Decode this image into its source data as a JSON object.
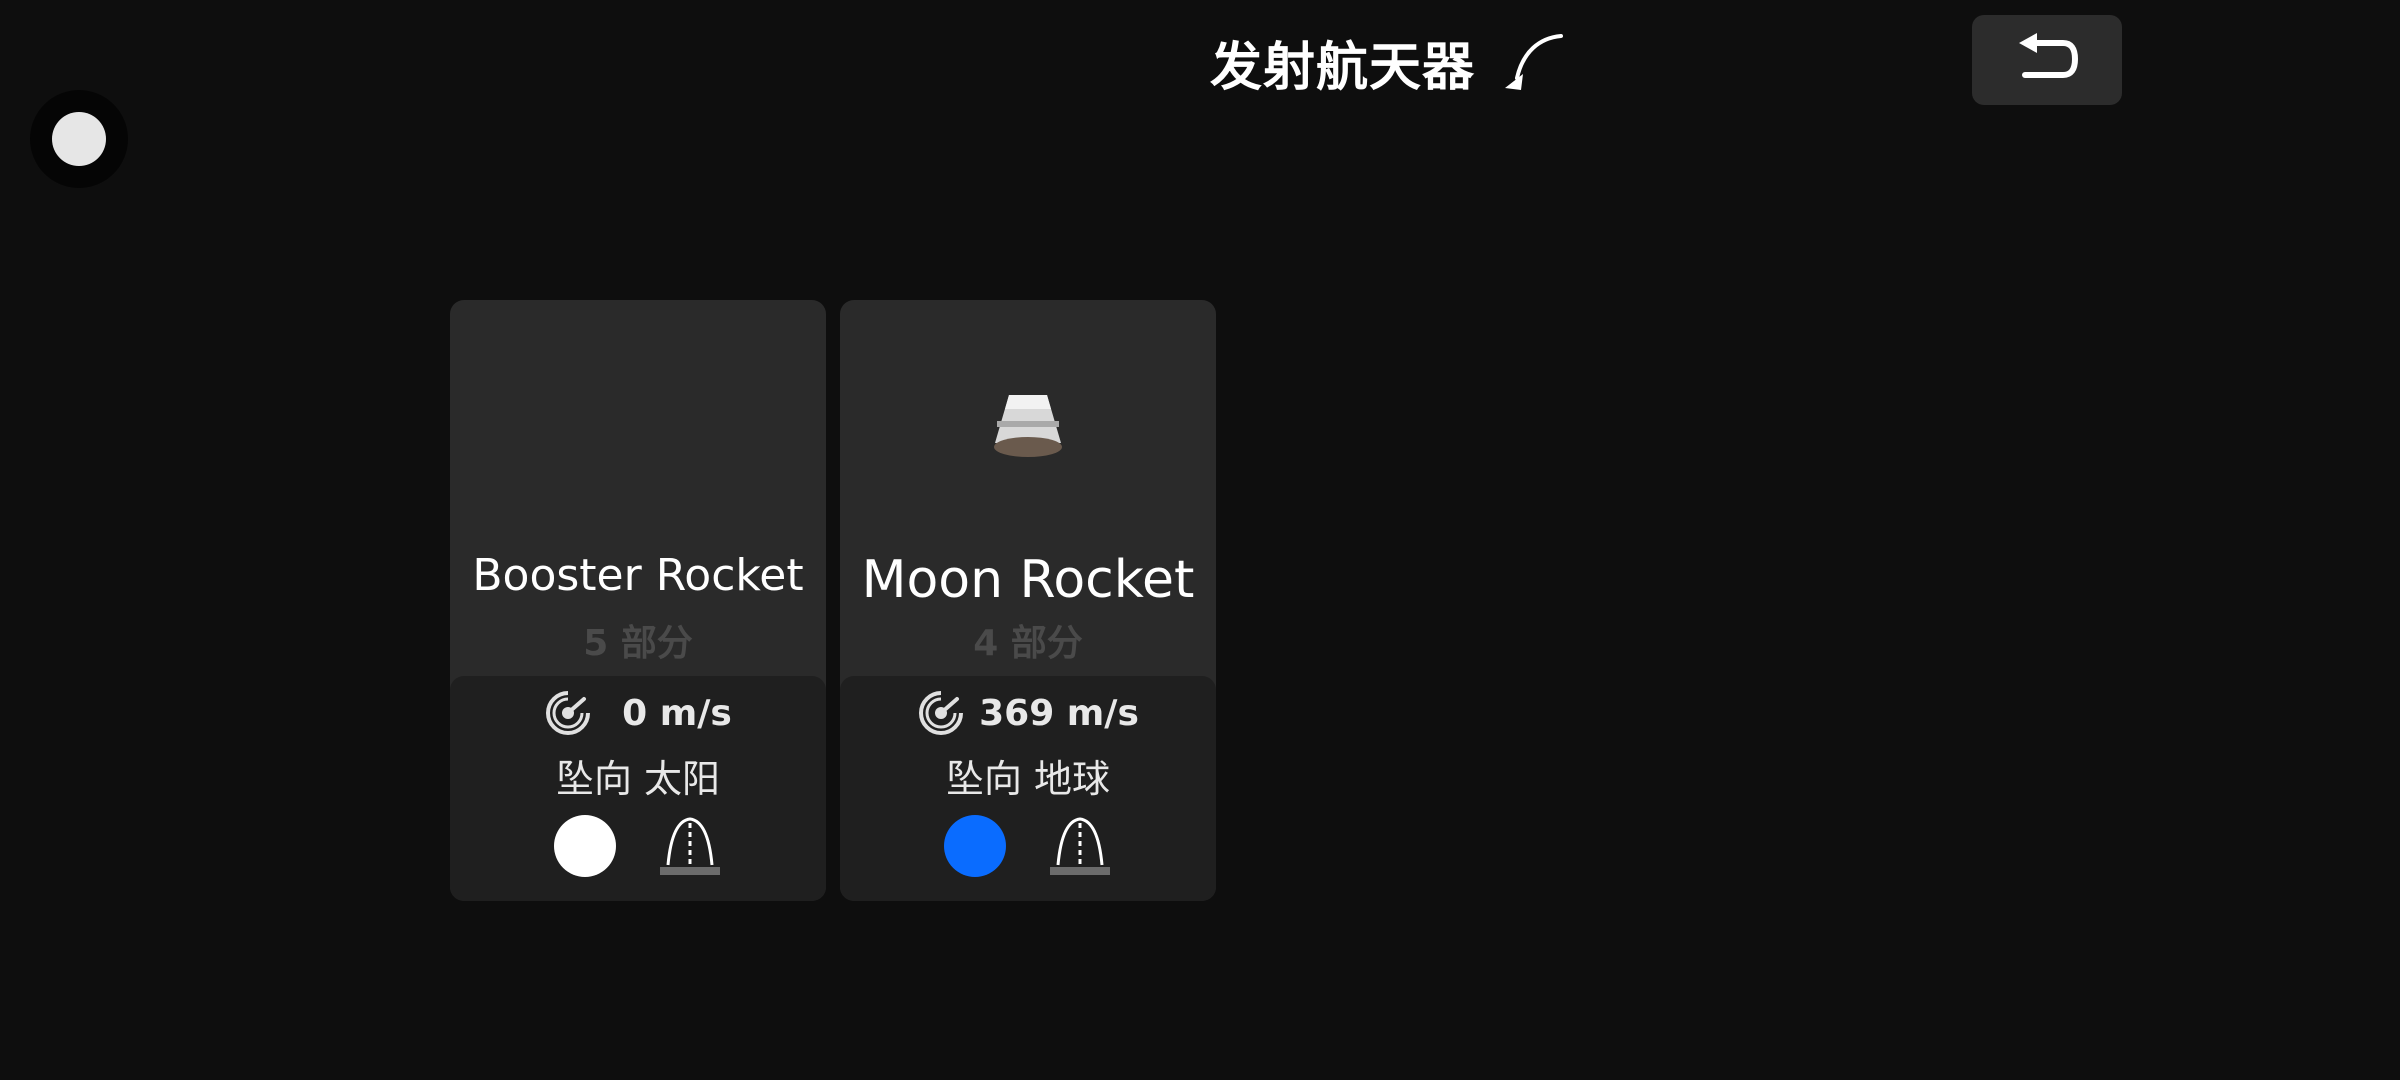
{
  "header": {
    "title": "发射航天器",
    "back_icon": "undo-arrow-icon",
    "title_icon": "launch-arc-icon"
  },
  "corner_toggle": {
    "icon": "circle-toggle-icon"
  },
  "crafts": [
    {
      "name": "Booster Rocket",
      "parts": "5 部分",
      "speed": "0 m/s",
      "falling": "坠向 太阳",
      "planet_color": "#ffffff",
      "has_preview": false
    },
    {
      "name": "Moon Rocket",
      "parts": "4 部分",
      "speed": "369 m/s",
      "falling": "坠向 地球",
      "planet_color": "#0a6cff",
      "has_preview": true
    }
  ],
  "colors": {
    "background": "#0e0e0e",
    "card": "#2a2a2a",
    "card_info": "#1f1f1f",
    "sun": "#ffffff",
    "earth": "#0a6cff"
  }
}
